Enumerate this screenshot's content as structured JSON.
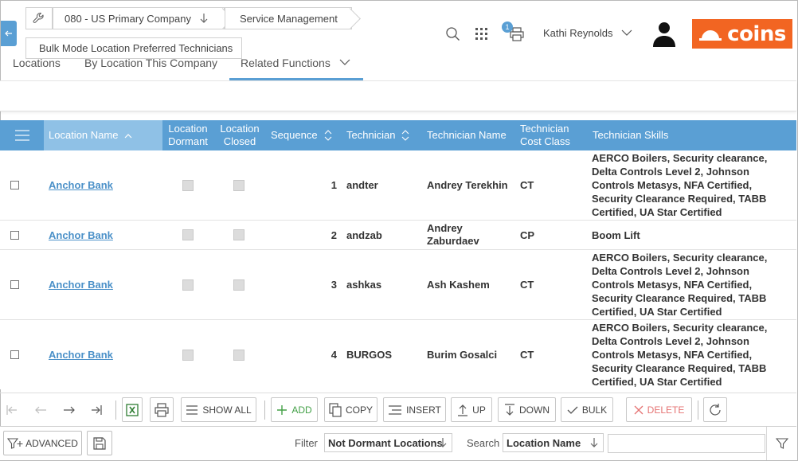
{
  "header": {
    "breadcrumb": {
      "company": "080 - US Primary Company",
      "module": "Service Management",
      "page": "Bulk Mode Location Preferred Technicians"
    },
    "notification_count": "1",
    "user_name": "Kathi Reynolds",
    "brand_text": "coins",
    "brand_color": "#f26522"
  },
  "tabs": [
    {
      "label": "Locations"
    },
    {
      "label": "By Location This Company"
    },
    {
      "label": "Related Functions",
      "active": true
    }
  ],
  "grid": {
    "accent_color": "#5a9fd4",
    "columns": {
      "location_name": "Location Name",
      "location_dormant": "Location Dormant",
      "location_closed": "Location Closed",
      "sequence": "Sequence",
      "technician": "Technician",
      "technician_name": "Technician Name",
      "technician_cost_class": "Technician Cost Class",
      "technician_skills": "Technician Skills"
    },
    "rows": [
      {
        "location": "Anchor Bank",
        "sequence": "1",
        "technician": "andter",
        "technician_name": "Andrey Terekhin",
        "cost_class": "CT",
        "skills": "AERCO Boilers, Security clearance, Delta Controls Level 2, Johnson Controls Metasys, NFA Certified, Security Clearance Required, TABB Certified, UA Star Certified"
      },
      {
        "location": "Anchor Bank",
        "sequence": "2",
        "technician": "andzab",
        "technician_name": "Andrey Zaburdaev",
        "cost_class": "CP",
        "skills": "Boom Lift"
      },
      {
        "location": "Anchor Bank",
        "sequence": "3",
        "technician": "ashkas",
        "technician_name": "Ash Kashem",
        "cost_class": "CT",
        "skills": "AERCO Boilers, Security clearance, Delta Controls Level 2, Johnson Controls Metasys, NFA Certified, Security Clearance Required, TABB Certified, UA Star Certified"
      },
      {
        "location": "Anchor Bank",
        "sequence": "4",
        "technician": "BURGOS",
        "technician_name": "Burim Gosalci",
        "cost_class": "CT",
        "skills": "AERCO Boilers, Security clearance, Delta Controls Level 2, Johnson Controls Metasys, NFA Certified, Security Clearance Required, TABB Certified, UA Star Certified"
      }
    ]
  },
  "toolbar": {
    "show_all": "SHOW ALL",
    "add": "ADD",
    "copy": "COPY",
    "insert": "INSERT",
    "up": "UP",
    "down": "DOWN",
    "bulk": "BULK",
    "delete": "DELETE"
  },
  "bottom": {
    "advanced": "ADVANCED",
    "filter_label": "Filter",
    "filter_value": "Not Dormant Locations",
    "search_label": "Search",
    "search_field": "Location Name",
    "search_value": ""
  }
}
